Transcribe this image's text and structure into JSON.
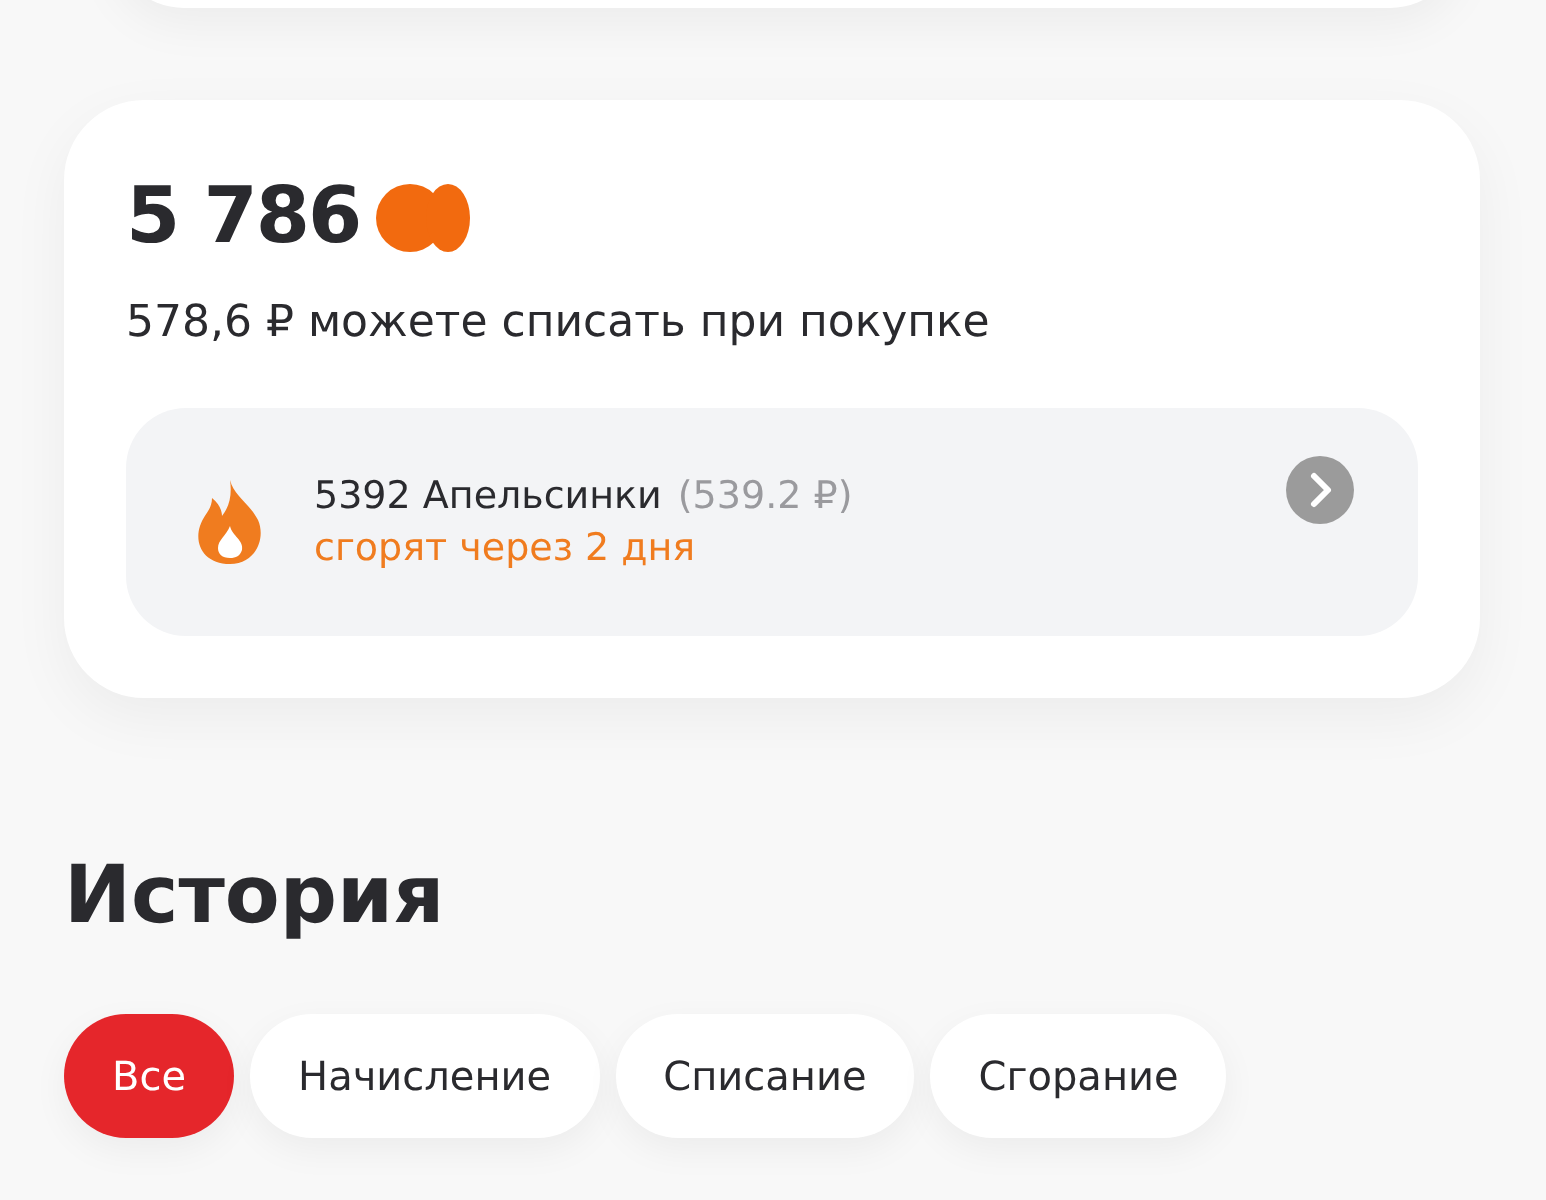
{
  "balance": {
    "amount": "5 786",
    "subtitle": "578,6 ₽ можете списать при покупке"
  },
  "expiring": {
    "title": "5392 Апельсинки",
    "amount": "(539.2 ₽)",
    "note": "сгорят через 2 дня"
  },
  "history": {
    "title": "История",
    "filters": [
      {
        "label": "Все",
        "selected": true
      },
      {
        "label": "Начисление",
        "selected": false
      },
      {
        "label": "Списание",
        "selected": false
      },
      {
        "label": "Сгорание",
        "selected": false
      }
    ]
  }
}
